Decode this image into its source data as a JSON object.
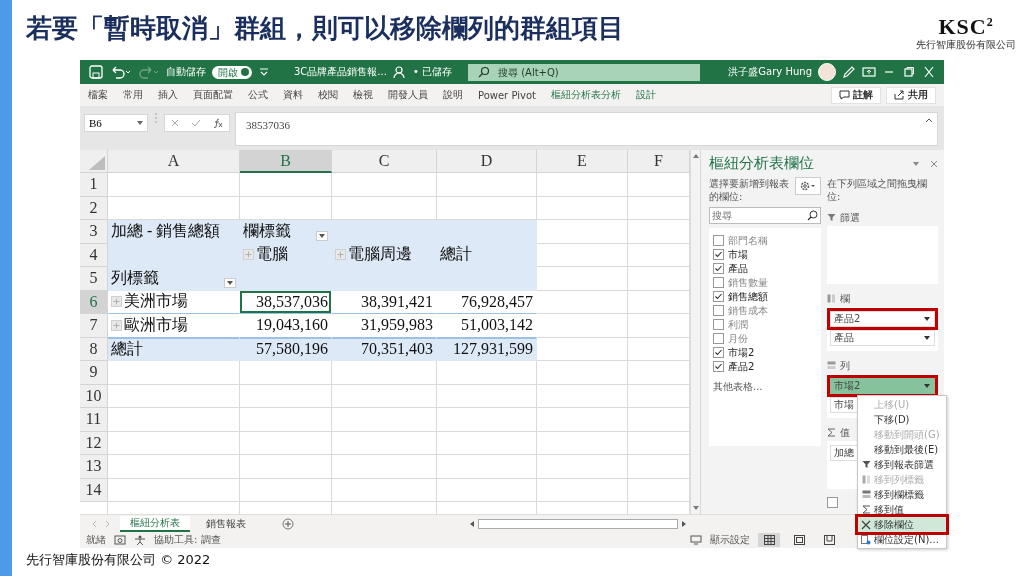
{
  "slide": {
    "title": "若要「暫時取消」群組，則可以移除欄列的群組項目",
    "logo": {
      "text": "KSC",
      "superscript": "2",
      "caption": "先行智庫股份有限公司"
    },
    "footer": "先行智庫股份有限公司 © 2022"
  },
  "titlebar": {
    "autosave_label": "自動儲存",
    "autosave": {
      "label": "開啟",
      "on": true
    },
    "filename": "3C品牌產品銷售報...",
    "save_status": "• 已儲存",
    "search_placeholder": "搜尋 (Alt+Q)",
    "user": "洪子盛Gary Hung"
  },
  "ribbon_tabs": [
    {
      "label": "檔案",
      "contextual": false
    },
    {
      "label": "常用",
      "contextual": false
    },
    {
      "label": "插入",
      "contextual": false
    },
    {
      "label": "頁面配置",
      "contextual": false
    },
    {
      "label": "公式",
      "contextual": false
    },
    {
      "label": "資料",
      "contextual": false
    },
    {
      "label": "校閱",
      "contextual": false
    },
    {
      "label": "檢視",
      "contextual": false
    },
    {
      "label": "開發人員",
      "contextual": false
    },
    {
      "label": "說明",
      "contextual": false
    },
    {
      "label": "Power Pivot",
      "contextual": false
    },
    {
      "label": "樞紐分析表分析",
      "contextual": true
    },
    {
      "label": "設計",
      "contextual": true
    }
  ],
  "ribbon_buttons": [
    {
      "label": "註解",
      "kind": "comment"
    },
    {
      "label": "共用",
      "kind": "share"
    }
  ],
  "formula_bar": {
    "name_box": "B6",
    "formula": "38537036"
  },
  "sheet": {
    "columns": [
      {
        "label": "A",
        "selected": false
      },
      {
        "label": "B",
        "selected": true
      },
      {
        "label": "C",
        "selected": false
      },
      {
        "label": "D",
        "selected": false
      },
      {
        "label": "E",
        "selected": false
      },
      {
        "label": "F",
        "selected": false
      }
    ],
    "rows": [
      {
        "number": "1",
        "selected": false,
        "kind": "plain"
      },
      {
        "number": "2",
        "selected": false,
        "kind": "plain"
      },
      {
        "number": "3",
        "selected": false,
        "kind": "header",
        "cells": [
          {
            "kind": "label",
            "text": "加總 - 銷售總額",
            "selected": false,
            "expander": false,
            "filter_button": false
          },
          {
            "kind": "label",
            "text": "欄標籤",
            "selected": false,
            "expander": false,
            "filter_button": true
          },
          {
            "kind": "empty"
          },
          {
            "kind": "empty"
          },
          {
            "kind": "empty"
          },
          {
            "kind": "empty"
          }
        ]
      },
      {
        "number": "4",
        "selected": false,
        "kind": "header",
        "cells": [
          {
            "kind": "empty"
          },
          {
            "kind": "label",
            "text": "電腦",
            "selected": false,
            "expander": true,
            "filter_button": false
          },
          {
            "kind": "label",
            "text": "電腦周邊",
            "selected": false,
            "expander": true,
            "filter_button": false
          },
          {
            "kind": "label",
            "text": "總計",
            "selected": false,
            "expander": false,
            "filter_button": false
          },
          {
            "kind": "empty"
          },
          {
            "kind": "empty"
          }
        ]
      },
      {
        "number": "5",
        "selected": false,
        "kind": "header",
        "cells": [
          {
            "kind": "label",
            "text": "列標籤",
            "selected": false,
            "expander": false,
            "filter_button": true
          },
          {
            "kind": "empty"
          },
          {
            "kind": "empty"
          },
          {
            "kind": "empty"
          },
          {
            "kind": "empty"
          },
          {
            "kind": "empty"
          }
        ]
      },
      {
        "number": "6",
        "selected": true,
        "kind": "body",
        "cells": [
          {
            "kind": "label",
            "text": "美洲市場",
            "selected": false,
            "expander": true,
            "filter_button": false
          },
          {
            "kind": "number",
            "text": "38,537,036",
            "selected": true,
            "expander": false,
            "filter_button": false
          },
          {
            "kind": "number",
            "text": "38,391,421",
            "selected": false,
            "expander": false,
            "filter_button": false
          },
          {
            "kind": "number",
            "text": "76,928,457",
            "selected": false,
            "expander": false,
            "filter_button": false
          },
          {
            "kind": "empty"
          },
          {
            "kind": "empty"
          }
        ]
      },
      {
        "number": "7",
        "selected": false,
        "kind": "body",
        "cells": [
          {
            "kind": "label",
            "text": "歐洲市場",
            "selected": false,
            "expander": true,
            "filter_button": false
          },
          {
            "kind": "number",
            "text": "19,043,160",
            "selected": false,
            "expander": false,
            "filter_button": false
          },
          {
            "kind": "number",
            "text": "31,959,983",
            "selected": false,
            "expander": false,
            "filter_button": false
          },
          {
            "kind": "number",
            "text": "51,003,142",
            "selected": false,
            "expander": false,
            "filter_button": false
          },
          {
            "kind": "empty"
          },
          {
            "kind": "empty"
          }
        ]
      },
      {
        "number": "8",
        "selected": false,
        "kind": "total",
        "cells": [
          {
            "kind": "label",
            "text": "總計",
            "selected": false,
            "expander": false,
            "filter_button": false
          },
          {
            "kind": "number",
            "text": "57,580,196",
            "selected": false,
            "expander": false,
            "filter_button": false
          },
          {
            "kind": "number",
            "text": "70,351,403",
            "selected": false,
            "expander": false,
            "filter_button": false
          },
          {
            "kind": "number",
            "text": "127,931,599",
            "selected": false,
            "expander": false,
            "filter_button": false
          },
          {
            "kind": "empty"
          },
          {
            "kind": "empty"
          }
        ]
      },
      {
        "number": "9",
        "selected": false,
        "kind": "plain"
      },
      {
        "number": "10",
        "selected": false,
        "kind": "plain"
      },
      {
        "number": "11",
        "selected": false,
        "kind": "plain"
      },
      {
        "number": "12",
        "selected": false,
        "kind": "plain"
      },
      {
        "number": "13",
        "selected": false,
        "kind": "plain"
      },
      {
        "number": "14",
        "selected": false,
        "kind": "plain"
      }
    ]
  },
  "sheet_tabs": [
    {
      "label": "樞紐分析表",
      "selected": true
    },
    {
      "label": "銷售報表",
      "selected": false
    }
  ],
  "pane": {
    "title": "樞紐分析表欄位",
    "choose_prompt": "選擇要新增到報表的欄位:",
    "search_placeholder": "搜尋",
    "fields": [
      {
        "label": "部門名稱",
        "checked": false
      },
      {
        "label": "市場",
        "checked": true
      },
      {
        "label": "產品",
        "checked": true
      },
      {
        "label": "銷售數量",
        "checked": false
      },
      {
        "label": "銷售總額",
        "checked": true
      },
      {
        "label": "銷售成本",
        "checked": false
      },
      {
        "label": "利潤",
        "checked": false
      },
      {
        "label": "月份",
        "checked": false
      },
      {
        "label": "市場2",
        "checked": true
      },
      {
        "label": "產品2",
        "checked": true
      }
    ],
    "more_tables": "其他表格...",
    "drag_prompt": "在下列區域之間拖曳欄位:",
    "areas": [
      {
        "kind": "filter",
        "label": "篩選"
      },
      {
        "kind": "columns",
        "label": "欄",
        "items": [
          {
            "label": "產品2",
            "selected": false,
            "outlined": true
          },
          {
            "label": "產品",
            "selected": false,
            "outlined": false
          }
        ]
      },
      {
        "kind": "rows",
        "label": "列",
        "items": [
          {
            "label": "市場2",
            "selected": true,
            "outlined": true
          },
          {
            "label": "市場",
            "selected": false,
            "outlined": false
          }
        ]
      },
      {
        "kind": "values",
        "label": "值",
        "items": [
          {
            "label": "加總",
            "selected": false,
            "outlined": false
          }
        ]
      }
    ],
    "defer_update": {
      "checked": false
    }
  },
  "context_menu": [
    {
      "label": "上移(U)",
      "kind": "plain",
      "disabled": true,
      "selected": false,
      "outlined": false
    },
    {
      "label": "下移(D)",
      "kind": "plain",
      "disabled": false,
      "selected": false,
      "outlined": false
    },
    {
      "label": "移動到開頭(G)",
      "kind": "plain",
      "disabled": true,
      "selected": false,
      "outlined": false
    },
    {
      "label": "移動到最後(E)",
      "kind": "plain",
      "disabled": false,
      "selected": false,
      "outlined": false
    },
    {
      "label": "移到報表篩選",
      "kind": "filter",
      "disabled": false,
      "selected": false,
      "outlined": false
    },
    {
      "label": "移到列標籤",
      "kind": "rows",
      "disabled": true,
      "selected": false,
      "outlined": false
    },
    {
      "label": "移到欄標籤",
      "kind": "columns",
      "disabled": false,
      "selected": false,
      "outlined": false
    },
    {
      "label": "移到值",
      "kind": "sigma",
      "disabled": false,
      "selected": false,
      "outlined": false
    },
    {
      "label": "移除欄位",
      "kind": "remove",
      "disabled": false,
      "selected": true,
      "outlined": true
    },
    {
      "label": "欄位設定(N)...",
      "kind": "settings",
      "disabled": false,
      "selected": false,
      "outlined": false
    }
  ],
  "status_bar": {
    "ready": "就緒",
    "accessibility": "協助工具: 調查",
    "display_settings": "顯示設定",
    "views": [
      {
        "kind": "normal",
        "selected": true
      },
      {
        "kind": "page-layout",
        "selected": false
      },
      {
        "kind": "page-break",
        "selected": false
      }
    ]
  }
}
